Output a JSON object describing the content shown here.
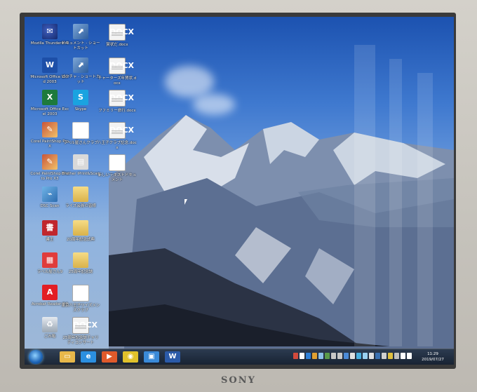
{
  "desktop": {
    "icons": [
      {
        "label": "Mozilla Thunderbird",
        "icon": "thunderbird-icon",
        "glyph": "✉"
      },
      {
        "label": "ドキュメント - ショートカット",
        "icon": "shortcut-icon",
        "glyph": "⬈"
      },
      {
        "label": "賞状だ.docx",
        "icon": "docx-icon",
        "glyph": "DOCX"
      },
      {
        "label": "Microsoft Office Word 2003",
        "icon": "word-icon",
        "glyph": "W"
      },
      {
        "label": "ピクチャ - ショートカット",
        "icon": "shortcut-icon",
        "glyph": "⬈"
      },
      {
        "label": "チャーターズ年賀状.docx",
        "icon": "docx-icon",
        "glyph": "DOCX"
      },
      {
        "label": "Microsoft Office Excel 2003",
        "icon": "excel-icon",
        "glyph": "X"
      },
      {
        "label": "Skype",
        "icon": "skype-icon",
        "glyph": "S"
      },
      {
        "label": "ファミリー旅行.docx",
        "icon": "docx-icon",
        "glyph": "DOCX"
      },
      {
        "label": "Corel PaintShop Pro X",
        "icon": "corel-icon",
        "glyph": "✎"
      },
      {
        "label": "ラベル屋さんクラブ",
        "icon": "label-app-icon",
        "glyph": "e"
      },
      {
        "label": "八王子クラブ記念.docx",
        "icon": "docx-icon",
        "glyph": "DOCX"
      },
      {
        "label": "Corel PaintShop Photo Pro X3",
        "icon": "corel-icon",
        "glyph": "✎"
      },
      {
        "label": "Brother iPrint&Scan",
        "icon": "printer-icon",
        "glyph": "▤"
      },
      {
        "label": "新しいテキストドキュメント",
        "icon": "word-doc-icon",
        "glyph": "W"
      },
      {
        "label": "DSC Scan",
        "icon": "scanner-icon",
        "glyph": "⌁"
      },
      {
        "label": "ライズ会員の皆様",
        "icon": "folder-icon",
        "glyph": ""
      },
      {
        "label": "書王",
        "icon": "app-red-icon",
        "glyph": "書"
      },
      {
        "label": "20周年記念式典",
        "icon": "folder-icon",
        "glyph": ""
      },
      {
        "label": "ラベル屋さん9",
        "icon": "label-icon",
        "glyph": "▦"
      },
      {
        "label": "25周年記念誌",
        "icon": "folder-icon",
        "glyph": ""
      },
      {
        "label": "Acrobat Reader DC",
        "icon": "acrobat-icon",
        "glyph": "A"
      },
      {
        "label": "東京八王子ワイズメンズクラブ",
        "icon": "word-doc-icon",
        "glyph": "W"
      },
      {
        "label": "ごみ箱",
        "icon": "recycle-bin-icon",
        "glyph": "♻"
      },
      {
        "label": "25周年記念誌チャリティコンサート",
        "icon": "docx-icon",
        "glyph": "DOCX"
      }
    ]
  },
  "taskbar": {
    "pinned": [
      {
        "name": "explorer-icon",
        "glyph": "▭",
        "color": "#e8b84a"
      },
      {
        "name": "internet-explorer-icon",
        "glyph": "e",
        "color": "#2b8fe0"
      },
      {
        "name": "media-player-icon",
        "glyph": "▶",
        "color": "#e05a2b"
      },
      {
        "name": "chrome-icon",
        "glyph": "◉",
        "color": "#e0c12b"
      },
      {
        "name": "windows-explorer-icon",
        "glyph": "▣",
        "color": "#3a8ad8"
      },
      {
        "name": "word-icon",
        "glyph": "W",
        "color": "#2b5aa8"
      }
    ],
    "clock": {
      "time": "11:29",
      "date": "2019/07/27"
    }
  },
  "monitor": {
    "brand": "SONY"
  }
}
